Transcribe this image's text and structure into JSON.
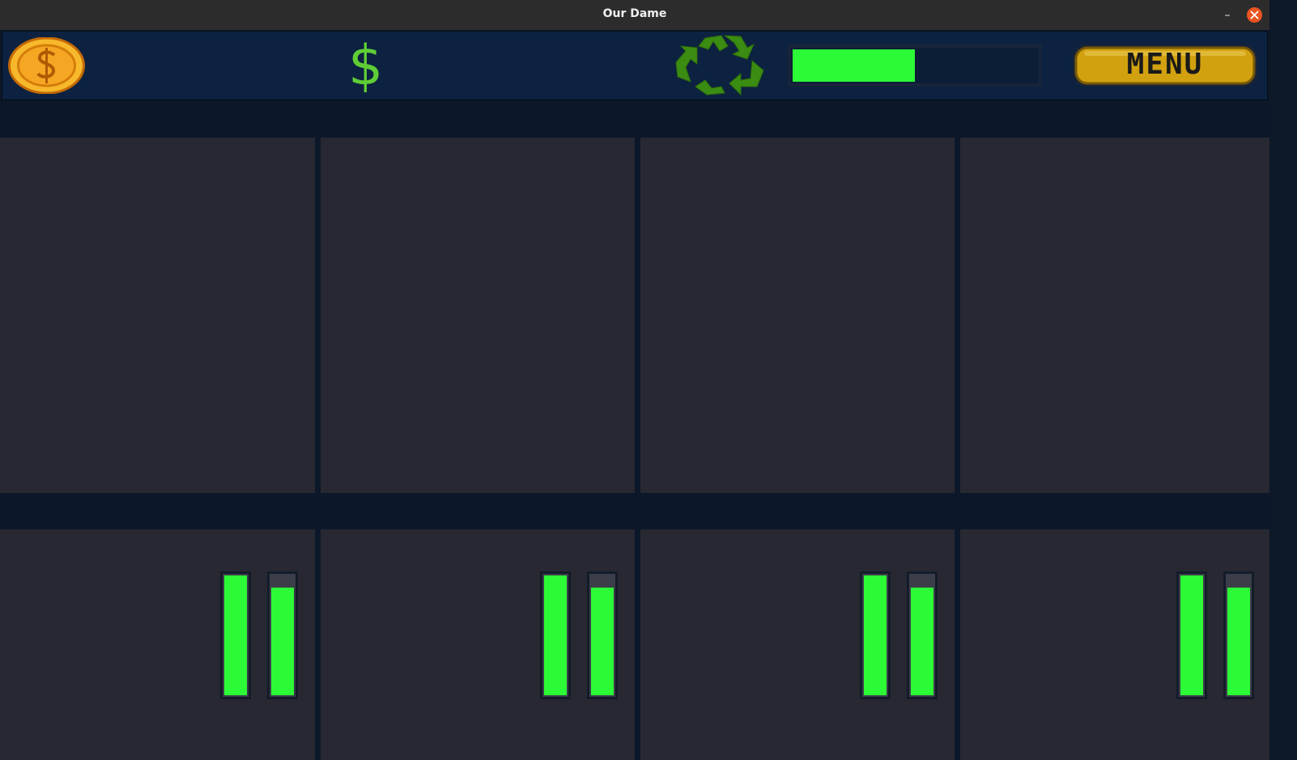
{
  "window": {
    "title": "Our Dame",
    "minimize_label": "–",
    "close_icon": "close-icon"
  },
  "hud": {
    "coin_icon": "coin-icon",
    "money_icon": "dollar-sign-icon",
    "money_symbol": "$",
    "recycle_icon": "recycle-icon",
    "recycle_progress": 0.5,
    "menu_label": "MENU"
  },
  "colors": {
    "meter_fill": "#2dfa37",
    "slot_bg": "#272832",
    "hud_bg": "#0c2240",
    "menu_gold": "#d1a10f",
    "coin_gold": "#f5a623",
    "recycle_green": "#3b8c12"
  },
  "top_slots": [
    {
      "id": 1
    },
    {
      "id": 2
    },
    {
      "id": 3
    },
    {
      "id": 4
    }
  ],
  "bottom_slots": [
    {
      "id": 1,
      "meters": [
        1.0,
        0.9
      ]
    },
    {
      "id": 2,
      "meters": [
        1.0,
        0.9
      ]
    },
    {
      "id": 3,
      "meters": [
        1.0,
        0.9
      ]
    },
    {
      "id": 4,
      "meters": [
        1.0,
        0.9
      ]
    }
  ]
}
